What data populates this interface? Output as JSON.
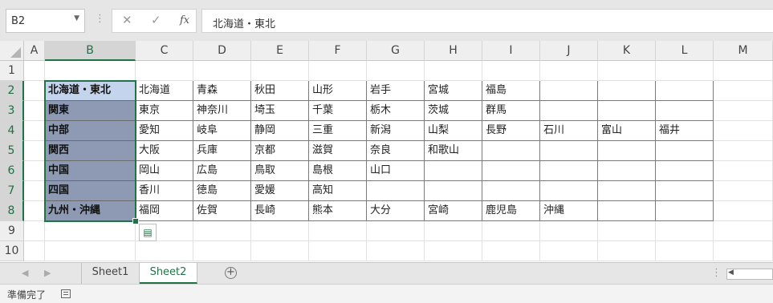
{
  "name_box": "B2",
  "formula": "北海道・東北",
  "formula_buttons": {
    "cancel": "✕",
    "enter": "✓",
    "fx": "fx"
  },
  "columns": [
    "A",
    "B",
    "C",
    "D",
    "E",
    "F",
    "G",
    "H",
    "I",
    "J",
    "K",
    "L",
    "M"
  ],
  "rows": [
    "1",
    "2",
    "3",
    "4",
    "5",
    "6",
    "7",
    "8",
    "9",
    "10"
  ],
  "table": [
    [
      "北海道・東北",
      "北海道",
      "青森",
      "秋田",
      "山形",
      "岩手",
      "宮城",
      "福島",
      "",
      "",
      ""
    ],
    [
      "関東",
      "東京",
      "神奈川",
      "埼玉",
      "千葉",
      "栃木",
      "茨城",
      "群馬",
      "",
      "",
      ""
    ],
    [
      "中部",
      "愛知",
      "岐阜",
      "静岡",
      "三重",
      "新潟",
      "山梨",
      "長野",
      "石川",
      "富山",
      "福井"
    ],
    [
      "関西",
      "大阪",
      "兵庫",
      "京都",
      "滋賀",
      "奈良",
      "和歌山",
      "",
      "",
      "",
      ""
    ],
    [
      "中国",
      "岡山",
      "広島",
      "鳥取",
      "島根",
      "山口",
      "",
      "",
      "",
      "",
      ""
    ],
    [
      "四国",
      "香川",
      "徳島",
      "愛媛",
      "高知",
      "",
      "",
      "",
      "",
      "",
      ""
    ],
    [
      "九州・沖縄",
      "福岡",
      "佐賀",
      "長崎",
      "熊本",
      "大分",
      "宮崎",
      "鹿児島",
      "沖縄",
      "",
      ""
    ]
  ],
  "sheets": [
    "Sheet1",
    "Sheet2"
  ],
  "active_sheet": "Sheet2",
  "status": "準備完了",
  "accent_color": "#217346",
  "selection_fill": "#8e9ab4",
  "icons": [
    "dropdown-icon",
    "cancel-icon",
    "enter-icon",
    "fx-icon",
    "select-all-icon",
    "quick-analysis-icon",
    "add-sheet-icon",
    "macro-record-icon"
  ]
}
